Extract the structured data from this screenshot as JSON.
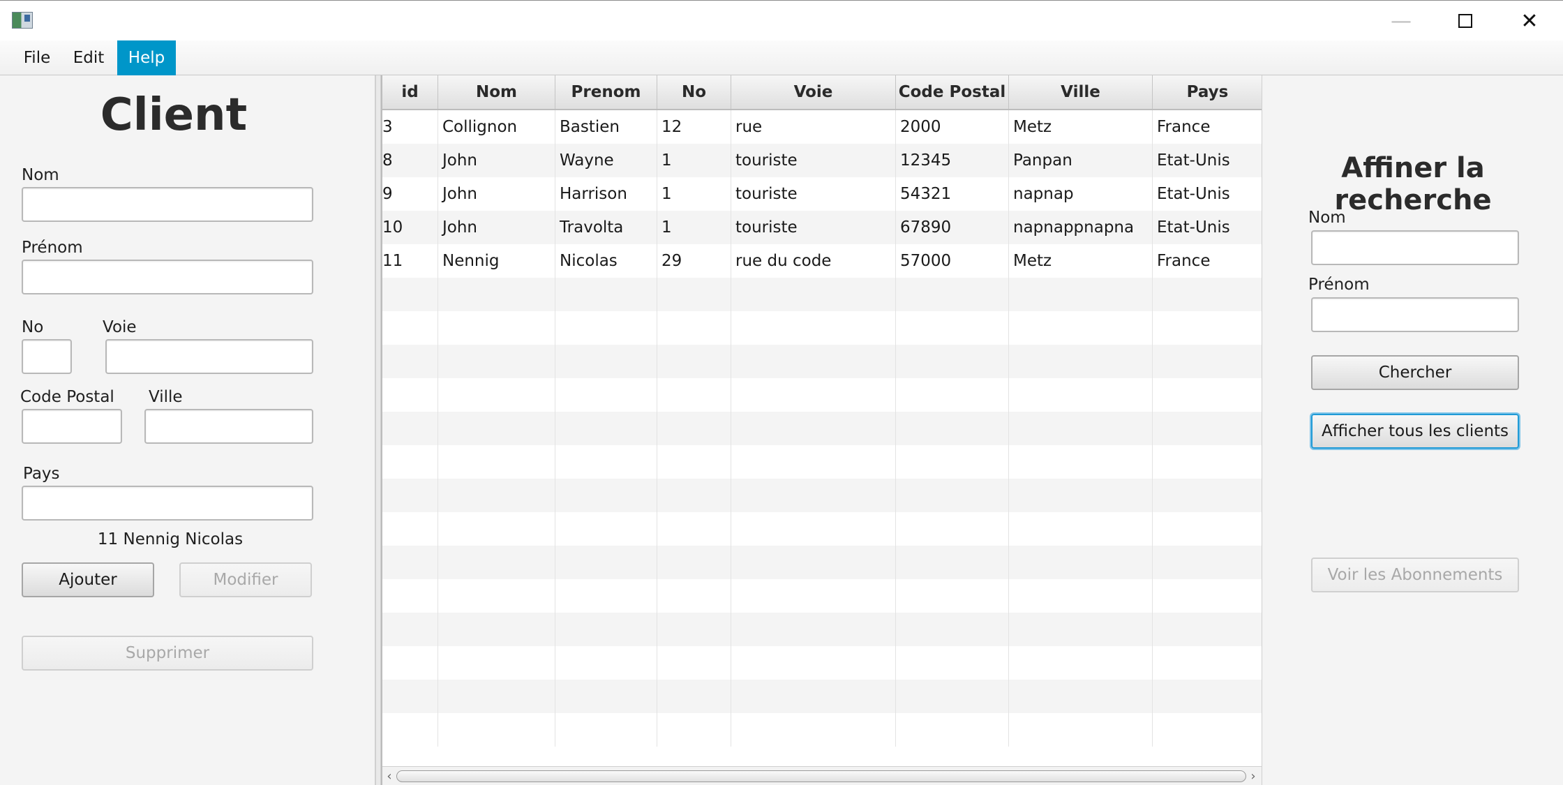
{
  "window": {
    "minimize_glyph": "—",
    "close_glyph": "✕"
  },
  "menu": {
    "items": [
      {
        "label": "File"
      },
      {
        "label": "Edit"
      },
      {
        "label": "Help",
        "active": true
      }
    ]
  },
  "client_form": {
    "title": "Client",
    "nom_label": "Nom",
    "nom_value": "",
    "prenom_label": "Prénom",
    "prenom_value": "",
    "no_label": "No",
    "no_value": "",
    "voie_label": "Voie",
    "voie_value": "",
    "code_postal_label": "Code Postal",
    "code_postal_value": "",
    "ville_label": "Ville",
    "ville_value": "",
    "pays_label": "Pays",
    "pays_value": "",
    "selected_client": "11 Nennig Nicolas",
    "ajouter_label": "Ajouter",
    "modifier_label": "Modifier",
    "supprimer_label": "Supprimer"
  },
  "table": {
    "columns": [
      "id",
      "Nom",
      "Prenom",
      "No",
      "Voie",
      "Code Postal",
      "Ville",
      "Pays"
    ],
    "rows": [
      [
        "3",
        "Collignon",
        "Bastien",
        "12",
        "rue",
        "2000",
        "Metz",
        "France"
      ],
      [
        "8",
        "John",
        "Wayne",
        "1",
        "touriste",
        "12345",
        "Panpan",
        "Etat-Unis"
      ],
      [
        "9",
        "John",
        "Harrison",
        "1",
        "touriste",
        "54321",
        "napnap",
        "Etat-Unis"
      ],
      [
        "10",
        "John",
        "Travolta",
        "1",
        "touriste",
        "67890",
        "napnappnapna",
        "Etat-Unis"
      ],
      [
        "11",
        "Nennig",
        "Nicolas",
        "29",
        "rue du code",
        "57000",
        "Metz",
        "France"
      ]
    ],
    "empty_rows": 14
  },
  "search_panel": {
    "title": "Affiner la recherche",
    "nom_label": "Nom",
    "nom_value": "",
    "prenom_label": "Prénom",
    "prenom_value": "",
    "chercher_label": "Chercher",
    "afficher_tous_label": "Afficher tous les clients",
    "voir_abonnements_label": "Voir les Abonnements"
  },
  "colors": {
    "menu_active": "#0096c9",
    "focus_ring": "#1f9ad6",
    "disabled_text": "#a8a8a8"
  }
}
